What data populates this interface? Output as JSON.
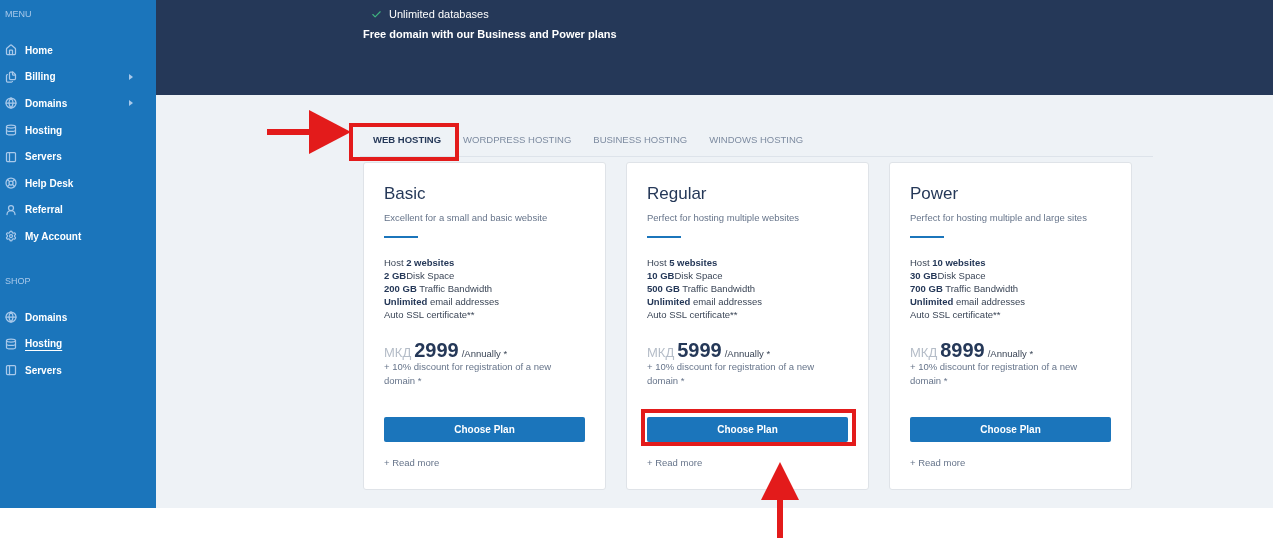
{
  "sidebar": {
    "sections": [
      {
        "heading": "MENU",
        "items": [
          {
            "label": "Home",
            "submenu": false,
            "selected": false
          },
          {
            "label": "Billing",
            "submenu": true,
            "selected": false
          },
          {
            "label": "Domains",
            "submenu": true,
            "selected": false
          },
          {
            "label": "Hosting",
            "submenu": false,
            "selected": false
          },
          {
            "label": "Servers",
            "submenu": false,
            "selected": false
          },
          {
            "label": "Help Desk",
            "submenu": false,
            "selected": false
          },
          {
            "label": "Referral",
            "submenu": false,
            "selected": false
          },
          {
            "label": "My Account",
            "submenu": false,
            "selected": false
          }
        ]
      },
      {
        "heading": "SHOP",
        "items": [
          {
            "label": "Domains",
            "submenu": false,
            "selected": false
          },
          {
            "label": "Hosting",
            "submenu": false,
            "selected": true
          },
          {
            "label": "Servers",
            "submenu": false,
            "selected": false
          }
        ]
      }
    ]
  },
  "hero": {
    "features": [
      "Unlimited databases"
    ],
    "note": "Free domain with our Business and Power plans"
  },
  "tabs": [
    {
      "label": "WEB HOSTING",
      "selected": true
    },
    {
      "label": "WORDPRESS HOSTING",
      "selected": false
    },
    {
      "label": "BUSINESS HOSTING",
      "selected": false
    },
    {
      "label": "WINDOWS HOSTING",
      "selected": false
    }
  ],
  "plans": [
    {
      "name": "Basic",
      "description": "Excellent for a small and basic website",
      "features": [
        [
          {
            "text": "Host "
          },
          {
            "text": "2 websites",
            "bold": true
          }
        ],
        [
          {
            "text": "2 GB",
            "bold": true
          },
          {
            "text": "Disk Space"
          }
        ],
        [
          {
            "text": "200 GB",
            "bold": true
          },
          {
            "text": " Traffic Bandwidth"
          }
        ],
        [
          {
            "text": "Unlimited",
            "bold": true
          },
          {
            "text": " email addresses"
          }
        ],
        [
          {
            "text": "Auto SSL certificate**"
          }
        ]
      ],
      "currency": "МКД",
      "amount": "2999",
      "period": "/Annually *",
      "note": "+ 10% discount for registration of a new domain *",
      "button": "Choose Plan",
      "link": "+ Read more"
    },
    {
      "name": "Regular",
      "description": "Perfect for hosting multiple websites",
      "features": [
        [
          {
            "text": "Host "
          },
          {
            "text": "5 websites",
            "bold": true
          }
        ],
        [
          {
            "text": "10 GB",
            "bold": true
          },
          {
            "text": "Disk Space"
          }
        ],
        [
          {
            "text": "500 GB",
            "bold": true
          },
          {
            "text": " Traffic Bandwidth"
          }
        ],
        [
          {
            "text": "Unlimited",
            "bold": true
          },
          {
            "text": " email addresses"
          }
        ],
        [
          {
            "text": "Auto SSL certificate**"
          }
        ]
      ],
      "currency": "МКД",
      "amount": "5999",
      "period": "/Annually *",
      "note": "+ 10% discount for registration of a new domain *",
      "button": "Choose Plan",
      "link": "+ Read more"
    },
    {
      "name": "Power",
      "description": "Perfect for hosting multiple and large sites",
      "features": [
        [
          {
            "text": "Host "
          },
          {
            "text": "10 websites",
            "bold": true
          }
        ],
        [
          {
            "text": "30 GB",
            "bold": true
          },
          {
            "text": "Disk Space"
          }
        ],
        [
          {
            "text": "700 GB",
            "bold": true
          },
          {
            "text": " Traffic Bandwidth"
          }
        ],
        [
          {
            "text": "Unlimited",
            "bold": true
          },
          {
            "text": " email addresses"
          }
        ],
        [
          {
            "text": "Auto SSL certificate**"
          }
        ]
      ],
      "currency": "МКД",
      "amount": "8999",
      "period": "/Annually *",
      "note": "+ 10% discount for registration of a new domain *",
      "button": "Choose Plan",
      "link": "+ Read more"
    }
  ]
}
